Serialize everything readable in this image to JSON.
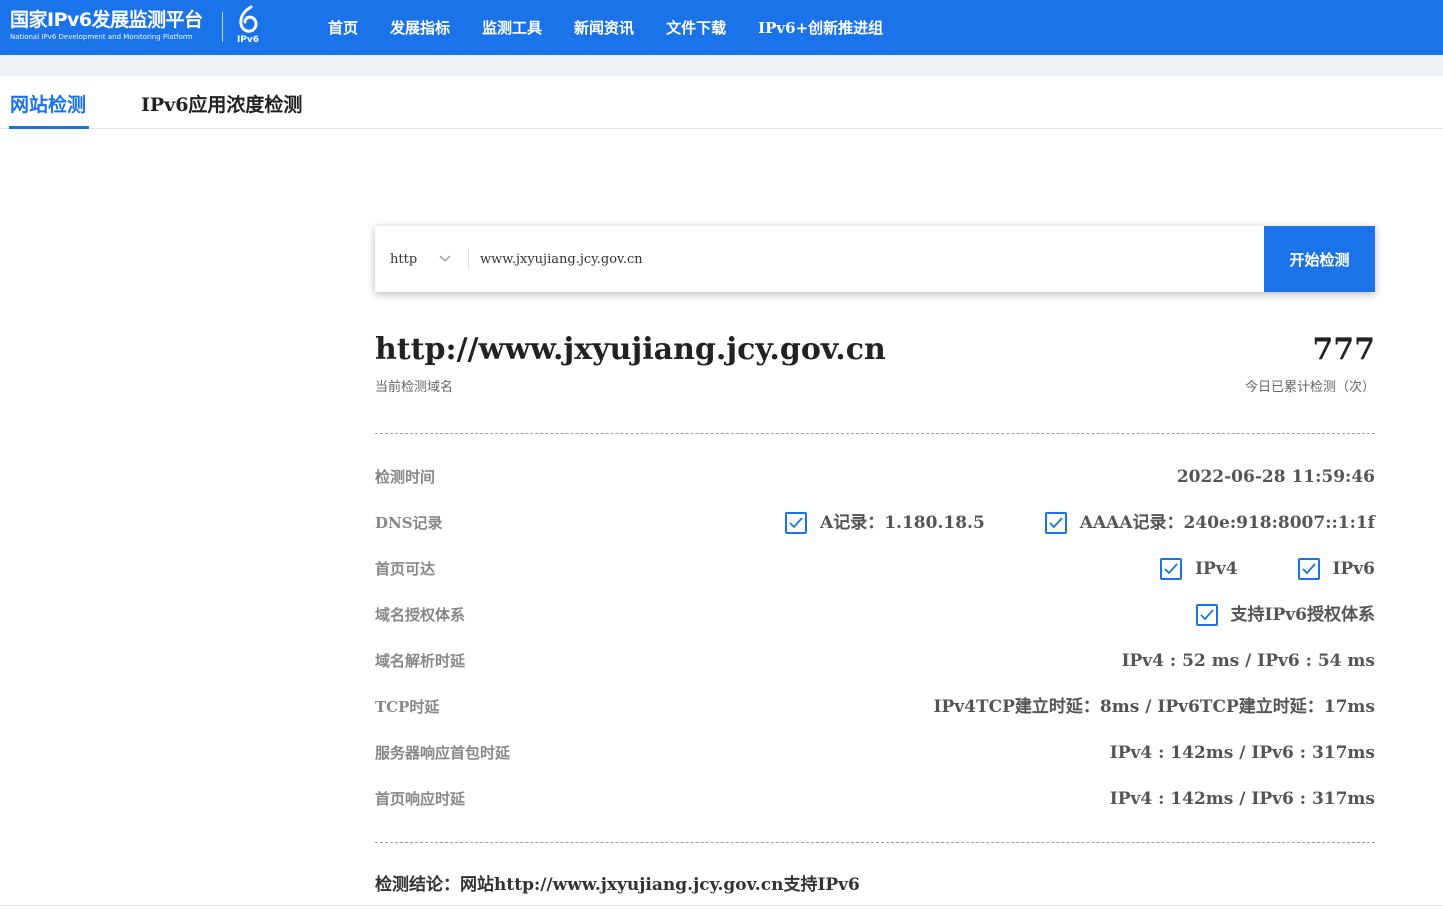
{
  "header": {
    "logo_title": "国家IPv6发展监测平台",
    "logo_subtitle": "National IPv6 Development and Monitoring Platform",
    "ipv6_mark": "IPv6",
    "nav": [
      "首页",
      "发展指标",
      "监测工具",
      "新闻资讯",
      "文件下载",
      "IPv6+创新推进组"
    ],
    "bg_color": "#1a73e8"
  },
  "tabs": {
    "active": "网站检测",
    "second": "IPv6应用浓度检测"
  },
  "search": {
    "protocol": "http",
    "url_value": "www.jxyujiang.jcy.gov.cn",
    "button_label": "开始检测"
  },
  "result": {
    "domain": "http://www.jxyujiang.jcy.gov.cn",
    "domain_caption": "当前检测域名",
    "count": "777",
    "count_caption": "今日已累计检测（次）",
    "rows": {
      "time": {
        "label": "检测时间",
        "value": "2022-06-28 11:59:46"
      },
      "dns": {
        "label": "DNS记录",
        "a_record": "A记录：1.180.18.5",
        "aaaa_record": "AAAA记录：240e:918:8007::1:1f"
      },
      "reach": {
        "label": "首页可达",
        "ipv4": "IPv4",
        "ipv6": "IPv6"
      },
      "auth": {
        "label": "域名授权体系",
        "value": "支持IPv6授权体系"
      },
      "resolve": {
        "label": "域名解析时延",
        "value": "IPv4 : 52 ms / IPv6 : 54 ms"
      },
      "tcp": {
        "label": "TCP时延",
        "value": "IPv4TCP建立时延：8ms / IPv6TCP建立时延：17ms"
      },
      "server": {
        "label": "服务器响应首包时延",
        "value": "IPv4 : 142ms / IPv6 : 317ms"
      },
      "homepage": {
        "label": "首页响应时延",
        "value": "IPv4 : 142ms / IPv6 : 317ms"
      }
    },
    "conclusion": "检测结论：网站http://www.jxyujiang.jcy.gov.cn支持IPv6"
  },
  "icons": {
    "checkbox": "checkmark-icon",
    "dropdown": "chevron-down-icon"
  }
}
